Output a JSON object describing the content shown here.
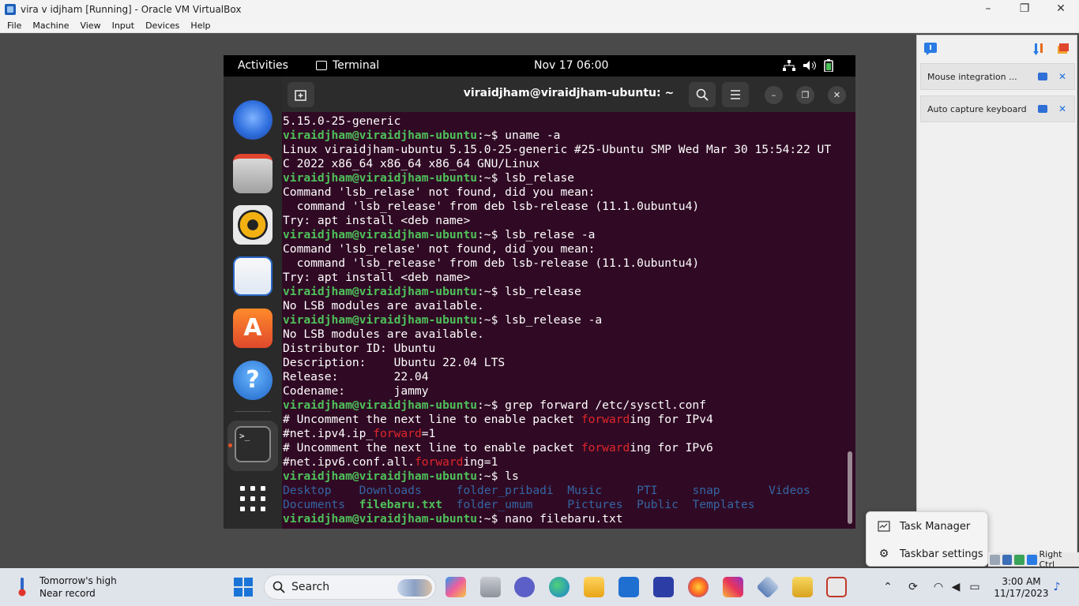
{
  "vbox": {
    "title": "vira v idjham  [Running] - Oracle VM VirtualBox",
    "menu": [
      "File",
      "Machine",
      "View",
      "Input",
      "Devices",
      "Help"
    ],
    "win_minimize": "–",
    "win_restore": "❐",
    "win_close": "✕",
    "notices": [
      {
        "text": "Mouse integration ..."
      },
      {
        "text": "Auto capture keyboard ..."
      }
    ],
    "status_label": "Right Ctrl"
  },
  "gnome": {
    "activities": "Activities",
    "app": "Terminal",
    "clock": "Nov 17  06:00"
  },
  "terminal": {
    "title": "viraidjham@viraidjham-ubuntu: ~",
    "prompt_user": "viraidjham@viraidjham-ubuntu",
    "prompt_suffix": ":~$ ",
    "lines": [
      {
        "kind": "out",
        "text": "5.15.0-25-generic"
      },
      {
        "kind": "cmd",
        "text": "uname -a"
      },
      {
        "kind": "out",
        "text": "Linux viraidjham-ubuntu 5.15.0-25-generic #25-Ubuntu SMP Wed Mar 30 15:54:22 UT"
      },
      {
        "kind": "out",
        "text": "C 2022 x86_64 x86_64 x86_64 GNU/Linux"
      },
      {
        "kind": "cmd",
        "text": "lsb_relase"
      },
      {
        "kind": "out",
        "text": "Command 'lsb_relase' not found, did you mean:"
      },
      {
        "kind": "out",
        "text": "  command 'lsb_release' from deb lsb-release (11.1.0ubuntu4)"
      },
      {
        "kind": "out",
        "text": "Try: apt install <deb name>"
      },
      {
        "kind": "cmd",
        "text": "lsb_relase -a"
      },
      {
        "kind": "out",
        "text": "Command 'lsb_relase' not found, did you mean:"
      },
      {
        "kind": "out",
        "text": "  command 'lsb_release' from deb lsb-release (11.1.0ubuntu4)"
      },
      {
        "kind": "out",
        "text": "Try: apt install <deb name>"
      },
      {
        "kind": "cmd",
        "text": "lsb_release"
      },
      {
        "kind": "out",
        "text": "No LSB modules are available."
      },
      {
        "kind": "cmd",
        "text": "lsb_release -a"
      },
      {
        "kind": "out",
        "text": "No LSB modules are available."
      },
      {
        "kind": "out",
        "text": "Distributor ID:\tUbuntu"
      },
      {
        "kind": "out",
        "text": "Description:\tUbuntu 22.04 LTS"
      },
      {
        "kind": "out",
        "text": "Release:\t22.04"
      },
      {
        "kind": "out",
        "text": "Codename:\tjammy"
      },
      {
        "kind": "cmd",
        "text": "grep forward /etc/sysctl.conf"
      },
      {
        "kind": "hl",
        "pre": "# Uncomment the next line to enable packet ",
        "hit": "forward",
        "post": "ing for IPv4"
      },
      {
        "kind": "hl",
        "pre": "#net.ipv4.ip_",
        "hit": "forward",
        "post": "=1"
      },
      {
        "kind": "hl",
        "pre": "# Uncomment the next line to enable packet ",
        "hit": "forward",
        "post": "ing for IPv6"
      },
      {
        "kind": "hl",
        "pre": "#net.ipv6.conf.all.",
        "hit": "forward",
        "post": "ing=1"
      },
      {
        "kind": "cmd",
        "text": "ls"
      },
      {
        "kind": "ls",
        "items": [
          {
            "name": "Desktop",
            "type": "dir"
          },
          {
            "name": "Downloads",
            "type": "dir"
          },
          {
            "name": "folder_pribadi",
            "type": "dir"
          },
          {
            "name": "Music",
            "type": "dir"
          },
          {
            "name": "PTI",
            "type": "dir"
          },
          {
            "name": "snap",
            "type": "dir"
          },
          {
            "name": "Videos",
            "type": "dir"
          }
        ],
        "widths": [
          11,
          14,
          16,
          10,
          8,
          11,
          6
        ]
      },
      {
        "kind": "ls",
        "items": [
          {
            "name": "Documents",
            "type": "dir"
          },
          {
            "name": "filebaru.txt",
            "type": "file"
          },
          {
            "name": "folder_umum",
            "type": "dir"
          },
          {
            "name": "Pictures",
            "type": "dir"
          },
          {
            "name": "Public",
            "type": "dir"
          },
          {
            "name": "Templates",
            "type": "dir"
          }
        ],
        "widths": [
          11,
          14,
          16,
          10,
          8,
          11
        ]
      },
      {
        "kind": "cmd",
        "text": "nano filebaru.txt"
      }
    ]
  },
  "context_menu": {
    "items": [
      "Task Manager",
      "Taskbar settings"
    ]
  },
  "taskbar": {
    "weather_line1": "Tomorrow's high",
    "weather_line2": "Near record",
    "search": "Search",
    "time": "3:00 AM",
    "date": "11/17/2023"
  },
  "colors": {
    "terminal_bg": "#300a24",
    "prompt_green": "#4ec15a",
    "dir_blue": "#3465a4",
    "grep_red": "#e0262b"
  }
}
